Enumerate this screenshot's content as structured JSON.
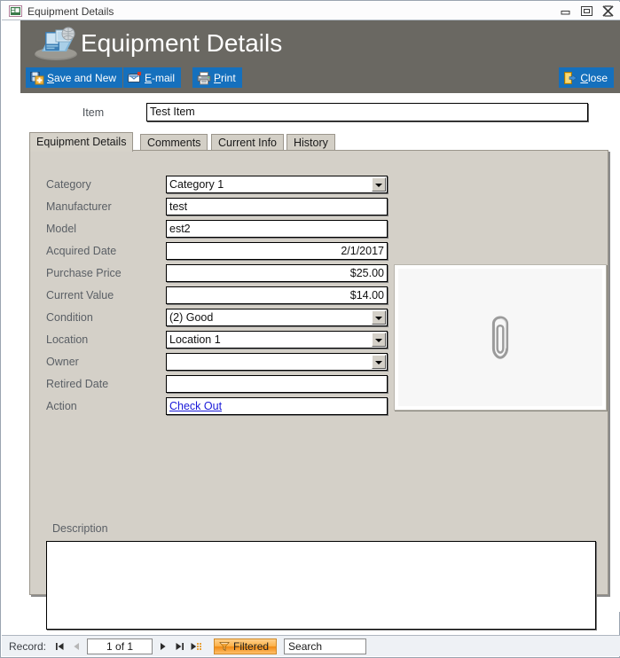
{
  "window": {
    "title": "Equipment Details",
    "icon": "form-view-icon",
    "buttons": {
      "minimize": "minimize-icon",
      "restore": "restore-icon",
      "close": "close-icon"
    }
  },
  "header": {
    "title": "Equipment Details",
    "logo_icon": "equipment-computer-icon",
    "background_color": "#6a6862",
    "button_color": "#1570bd",
    "actions": [
      {
        "id": "save-and-new",
        "label": "Save and New",
        "icon": "save-new-icon",
        "accel": "S"
      },
      {
        "id": "email",
        "label": "E-mail",
        "icon": "email-icon",
        "accel": "E"
      },
      {
        "id": "print",
        "label": "Print",
        "icon": "printer-icon",
        "accel": "P"
      },
      {
        "id": "close",
        "label": "Close",
        "icon": "close-door-icon",
        "accel": "C"
      }
    ]
  },
  "item": {
    "label": "Item",
    "value": "Test Item",
    "placeholder": ""
  },
  "tabs": [
    {
      "id": "equipment-details",
      "label": "Equipment Details",
      "active": true
    },
    {
      "id": "comments",
      "label": "Comments",
      "active": false
    },
    {
      "id": "current-info",
      "label": "Current Info",
      "active": false
    },
    {
      "id": "history",
      "label": "History",
      "active": false
    }
  ],
  "fields": [
    {
      "id": "category",
      "label": "Category",
      "value": "Category 1",
      "type": "combobox",
      "align": "left"
    },
    {
      "id": "manufacturer",
      "label": "Manufacturer",
      "value": "test",
      "type": "textbox",
      "align": "left"
    },
    {
      "id": "model",
      "label": "Model",
      "value": "est2",
      "type": "textbox",
      "align": "left"
    },
    {
      "id": "acquired-date",
      "label": "Acquired Date",
      "value": "2/1/2017",
      "type": "textbox",
      "align": "right"
    },
    {
      "id": "purchase-price",
      "label": "Purchase Price",
      "value": "$25.00",
      "type": "textbox",
      "align": "right"
    },
    {
      "id": "current-value",
      "label": "Current Value",
      "value": "$14.00",
      "type": "textbox",
      "align": "right"
    },
    {
      "id": "condition",
      "label": "Condition",
      "value": "(2) Good",
      "type": "combobox",
      "align": "left"
    },
    {
      "id": "location",
      "label": "Location",
      "value": "Location 1",
      "type": "combobox",
      "align": "left"
    },
    {
      "id": "owner",
      "label": "Owner",
      "value": "",
      "type": "combobox",
      "align": "left"
    },
    {
      "id": "retired-date",
      "label": "Retired Date",
      "value": "",
      "type": "textbox",
      "align": "left"
    },
    {
      "id": "action",
      "label": "Action",
      "value": "Check Out",
      "type": "hyperlink",
      "align": "left"
    }
  ],
  "attachment": {
    "icon": "paperclip-icon",
    "value": ""
  },
  "description": {
    "label": "Description",
    "value": ""
  },
  "navigator": {
    "record_label": "Record:",
    "position": "1 of 1",
    "first_icon": "first-record-icon",
    "previous_icon": "previous-record-icon",
    "next_icon": "next-record-icon",
    "last_icon": "last-record-icon",
    "new_icon": "new-record-icon",
    "filter_label": "Filtered",
    "filter_icon": "funnel-icon",
    "search_placeholder": "Search",
    "search_value": "Search"
  }
}
